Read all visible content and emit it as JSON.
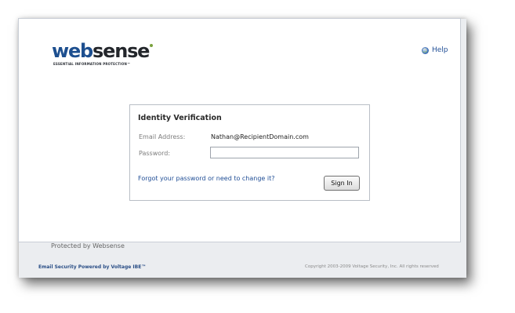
{
  "brand": {
    "logo_part1": "web",
    "logo_part2": "sense",
    "tagline": "ESSENTIAL INFORMATION PROTECTION™"
  },
  "header": {
    "help_label": "Help"
  },
  "form": {
    "title": "Identity Verification",
    "email_label": "Email Address:",
    "email_value": "Nathan@RecipientDomain.com",
    "password_label": "Password:",
    "password_value": "",
    "forgot_link": "Forgot your password or need to change it?",
    "signin_label": "Sign In"
  },
  "page": {
    "protected_by": "Protected by Websense"
  },
  "footer": {
    "powered_by": "Email Security Powered by Voltage IBE™",
    "copyright": "Copyright 2003-2009 Voltage Security, Inc. All rights reserved"
  },
  "colors": {
    "brand_blue": "#1d4f8f",
    "link_blue": "#1f4d95",
    "logo_dot_green": "#7aa23d"
  },
  "icons": {
    "help": "help-globe-icon"
  }
}
